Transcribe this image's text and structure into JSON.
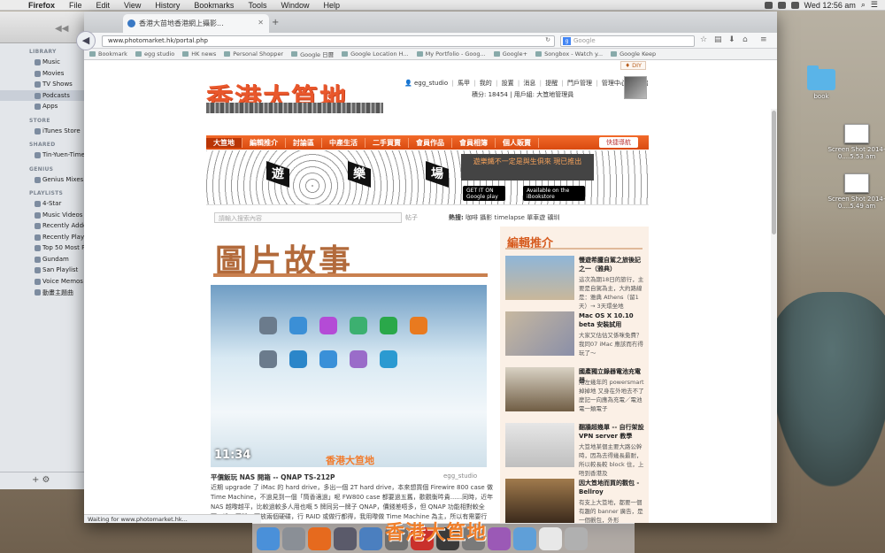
{
  "menubar": {
    "app": "Firefox",
    "items": [
      "File",
      "Edit",
      "View",
      "History",
      "Bookmarks",
      "Tools",
      "Window",
      "Help"
    ],
    "clock": "Wed 12:56 am"
  },
  "itunes": {
    "sections": [
      {
        "title": "LIBRARY",
        "items": [
          "Music",
          "Movies",
          "TV Shows",
          "Podcasts",
          "Apps"
        ]
      },
      {
        "title": "STORE",
        "items": [
          "iTunes Store"
        ]
      },
      {
        "title": "SHARED",
        "items": [
          "Tin-Yuen-Time(C"
        ]
      },
      {
        "title": "GENIUS",
        "items": [
          "Genius Mixes"
        ]
      },
      {
        "title": "PLAYLISTS",
        "items": [
          "4-Star",
          "Music Videos",
          "Recently Added",
          "Recently Played",
          "Top 50 Most Pla",
          "Gundam",
          "San Playlist",
          "Voice Memos",
          "動畫主題曲"
        ]
      }
    ],
    "selected": "Podcasts",
    "bottom": "+  ⚙"
  },
  "desktop": {
    "folder_label": "book",
    "shot1": "Screen Shot 2014-0....5.53 am",
    "shot2": "Screen Shot 2014-0....5.49 am"
  },
  "browser": {
    "tab_title": "香港大苗地香港網上攝影...",
    "url": "www.photomarket.hk/portal.php",
    "search_placeholder": "Google",
    "bookmarks": [
      "Bookmark",
      "egg studio",
      "HK news",
      "Personal Shopper",
      "Google 日曆",
      "Google Location H...",
      "My Portfolio - Goog...",
      "Google+",
      "Songbox - Watch y...",
      "Google Keep"
    ],
    "status": "Waiting for www.photomarket.hk..."
  },
  "site": {
    "diy": "♦ DIY",
    "logo": "香港大笪地",
    "user": {
      "name": "egg_studio",
      "links": [
        "馬甲",
        "我的",
        "設置",
        "消息",
        "提醒",
        "門戶管理",
        "管理中心",
        "退出"
      ],
      "points_label": "積分: 18454",
      "group_label": "用戶組: 大笪地管理員"
    },
    "nav": [
      "大笪地",
      "編輯推介",
      "討論區",
      "中產生活",
      "二手買賣",
      "會員作品",
      "會員相簿",
      "個人販賣"
    ],
    "quick_nav": "快捷導航",
    "banner": {
      "words": [
        "遊",
        "樂",
        "場"
      ],
      "promo": "遊樂鐵不一定是與生俱來 現已推出",
      "google_play": "GET IT ON Google play",
      "ibookstore": "Available on the iBookstore"
    },
    "search": {
      "placeholder": "請輸入搜索內容",
      "type": "帖子",
      "hot_label": "熱搜:",
      "hot": [
        "咖啡",
        "攝影",
        "timelapse",
        "單車遊",
        "礦圳"
      ]
    },
    "article": {
      "section_title": "圖片故事",
      "time": "11:34",
      "watermark": "香港大笪地",
      "title": "平價飯玩 NAS 開箱 -- QNAP TS-212P",
      "author": "egg_studio",
      "body": "近期 upgrade 了 iMac 的 hard drive，多出一個 2T hard drive，本來想買個 Firewire 800 case 做 Time Machine，不過見到一個「筒香適過」呢 FW800 case 都要過五舊，歡觀衡吽貴......同時，近年 NAS 越嚟越平，比較過較多人用也嘅 5 牌同另一牌子 QNAP，價錢差唔多，但 QNAP 功能相對較全面，造工不錯，可放兩個硬碟，行 RAID 或做行都得，我用嚟做 Time Machine 為主，所以有需要行 RAID，開箱！ 開箱後，發現有說明書，只有一張好簡單嘅紙，叫你（唔係教你）安裝硬碟，然後就電，之後用 browser 登入，我以前做"
    },
    "editor_picks": {
      "title": "編輯推介",
      "items": [
        {
          "title": "慢遊希臘自駕之旅後記之一（雅典）",
          "desc": "這次為期18日的旅行，主要是自駕為主，大約路線是：雅典 Athens（留1天）→ 3天環坐地"
        },
        {
          "title": "Mac OS X 10.10 beta 安裝試用",
          "desc": "大家又估估又係咪免費？我同07 iMac 應該而冇得玩了～"
        },
        {
          "title": "國產獨立錄器電池充電器",
          "desc": "用左幾年的 powersmart 掉掉地 又身在外地去不了麼記一向應為充電／電池電一類電子"
        },
        {
          "title": "翻牆超幾單 -- 自行架設 VPN server 教學",
          "desc": "大笪地某個主要大路公幹時，因為去得幾長最耐，所以較長較 block 住，上唔到香港及"
        },
        {
          "title": "因大笪地而買的觀包 - Bellroy",
          "desc": "有支上大笪地，都要一個有趣的 banner 廣告，是一個觀包，外形"
        }
      ]
    }
  }
}
